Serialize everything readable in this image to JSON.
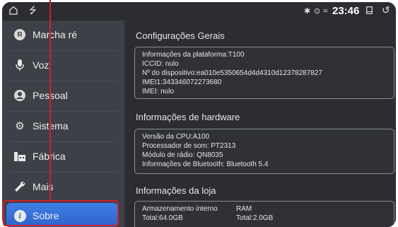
{
  "statusbar": {
    "time": "23:46",
    "icons": [
      "home-icon",
      "usb-icon",
      "bluetooth-icon",
      "location-icon",
      "wifi-icon",
      "recent-apps-icon",
      "back-icon"
    ]
  },
  "sidebar": {
    "items": [
      {
        "label": "Marcha ré",
        "icon": "reverse-gear-icon",
        "badge": "R"
      },
      {
        "label": "Voz",
        "icon": "microphone-icon"
      },
      {
        "label": "Pessoal",
        "icon": "person-icon"
      },
      {
        "label": "Sistema",
        "icon": "gears-icon"
      },
      {
        "label": "Fábrica",
        "icon": "factory-icon"
      },
      {
        "label": "Mais",
        "icon": "wrench-icon"
      },
      {
        "label": "Sobre",
        "icon": "info-icon",
        "active": true
      }
    ]
  },
  "main": {
    "general": {
      "title": "Configurações Gerais",
      "lines": [
        "Informações da plataforma:T100",
        "ICCID: nulo",
        "Nº do dispositivo:ea010e5350654d4d4310d12378287827",
        "IMEI1:343346072273680",
        "IMEI: nulo"
      ]
    },
    "hardware": {
      "title": "Informações de hardware",
      "lines": [
        "Versão da CPU:A100",
        "Processador de som: PT2313",
        "Módulo de rádio: QN8035",
        "Informações de Bluetooth: Bluetooth 5.4"
      ]
    },
    "store": {
      "title": "Informações da loja",
      "storage_label": "Armazenamento interno",
      "ram_label": "RAM",
      "storage_total": "Total:64.0GB",
      "ram_total": "Total:2.0GB"
    }
  },
  "colors": {
    "background": "#2b2d33",
    "sidebar": "#3d4047",
    "active": "#3a78e0",
    "annotation": "#d0202a"
  }
}
